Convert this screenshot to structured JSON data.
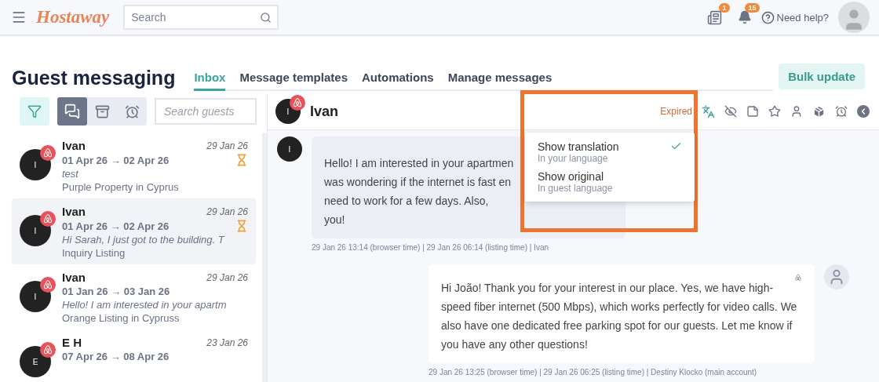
{
  "header": {
    "logo": "Hostaway",
    "search": {
      "placeholder": "Search"
    },
    "news_badge": "1",
    "notification_badge": "15",
    "help": "Need help?"
  },
  "page": {
    "title": "Guest messaging",
    "tabs": [
      {
        "label": "Inbox",
        "selected": true
      },
      {
        "label": "Message templates",
        "selected": false
      },
      {
        "label": "Automations",
        "selected": false
      },
      {
        "label": "Manage messages",
        "selected": false
      }
    ],
    "bulk_button": "Bulk update"
  },
  "filters": {
    "views": [
      {
        "kind": "inbox",
        "selected": true
      },
      {
        "kind": "archive",
        "selected": false
      },
      {
        "kind": "reminders",
        "selected": false
      }
    ],
    "search": {
      "placeholder": "Search guests"
    }
  },
  "conversations": [
    {
      "initial": "I",
      "name": "Ivan",
      "date": "29 Jan 26",
      "stay": "01 Apr 26 → 02 Apr 26",
      "pending": true,
      "preview": "test",
      "listing": "Purple Property in Cyprus",
      "selected": false
    },
    {
      "initial": "I",
      "name": "Ivan",
      "date": "29 Jan 26",
      "stay": "01 Apr 26 → 02 Apr 26",
      "pending": true,
      "preview": "Hi Sarah, I just got to the building. T",
      "listing": "Inquiry Listing",
      "selected": true
    },
    {
      "initial": "I",
      "name": "Ivan",
      "date": "29 Jan 26",
      "stay": "01 Jan 26 → 03 Jan 26",
      "pending": false,
      "preview": "Hello! I am interested in your apartm",
      "listing": "Orange Listing in Cypruss",
      "selected": false
    },
    {
      "initial": "E",
      "name": "E H",
      "date": "23 Jan 26",
      "stay": "07 Apr 26 → 08 Apr 26",
      "pending": false,
      "selected": false
    }
  ],
  "chat": {
    "guest_initial": "I",
    "guest_name": "Ivan",
    "status": "Expired",
    "messages": [
      {
        "kind": "guest",
        "initial": "I",
        "lines": [
          "Hello! I am interested in your apartmen",
          "was wondering if the internet is fast en",
          "need to work for a few days. Also,",
          "you!"
        ],
        "meta": "29 Jan 26 13:14 (browser time) | 29 Jan 26 06:14 (listing time) | Ivan"
      },
      {
        "kind": "host",
        "text": "Hi João! Thank you for your interest in our place. Yes, we have high-speed fiber internet (500 Mbps), which works perfectly for video calls. We also have one dedicated free parking spot for our guests. Let me know if you have any other questions!",
        "meta": "29 Jan 26 13:25 (browser time) | 29 Jan 26 06:25 (listing time) | Destiny Klocko (main account)"
      }
    ]
  },
  "translation_menu": {
    "options": [
      {
        "label": "Show translation",
        "hint": "In your language",
        "selected": true
      },
      {
        "label": "Show original",
        "hint": "In guest language",
        "selected": false
      }
    ]
  }
}
